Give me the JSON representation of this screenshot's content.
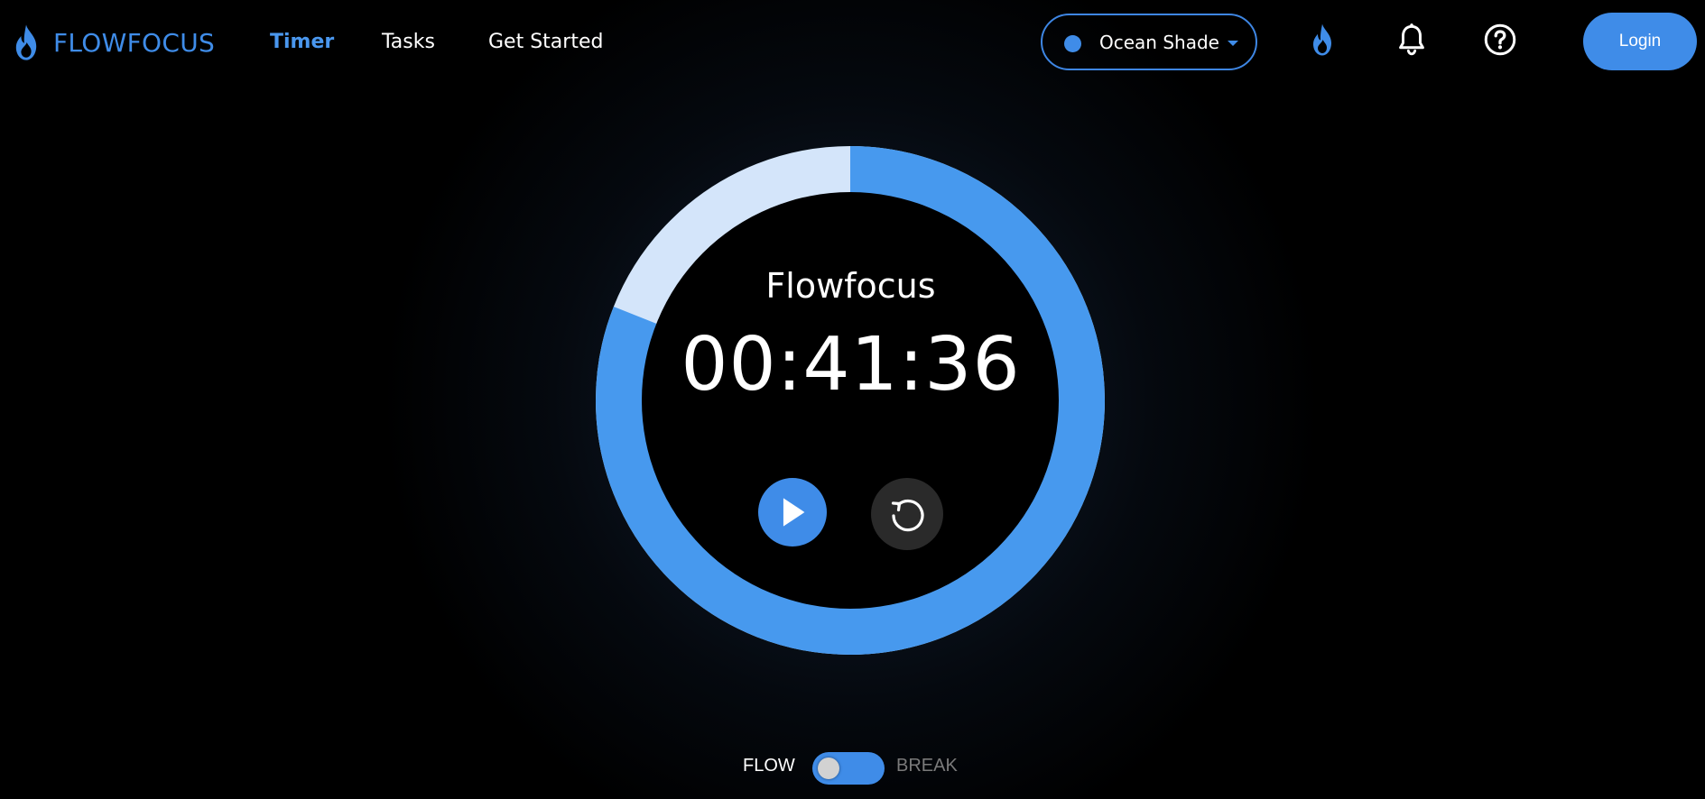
{
  "brand": {
    "name": "FLOWFOCUS",
    "icon": "flame-icon"
  },
  "nav": {
    "items": [
      {
        "label": "Timer",
        "active": true
      },
      {
        "label": "Tasks",
        "active": false
      },
      {
        "label": "Get Started",
        "active": false
      }
    ]
  },
  "theme_select": {
    "selected": "Ocean Shade",
    "color": "#3f8ce8"
  },
  "header_icons": [
    "flame-icon",
    "bell-icon",
    "help-icon"
  ],
  "login": {
    "label": "Login"
  },
  "timer": {
    "session_label": "Flowfocus",
    "time": "00:41:36",
    "progress_fraction": 0.81,
    "accent_color": "#4799ee",
    "track_color": "#d4e5fa"
  },
  "controls": {
    "play_icon": "play-icon",
    "reset_icon": "reset-icon"
  },
  "mode_switch": {
    "left_label": "FLOW",
    "right_label": "BREAK",
    "selected": "FLOW"
  }
}
